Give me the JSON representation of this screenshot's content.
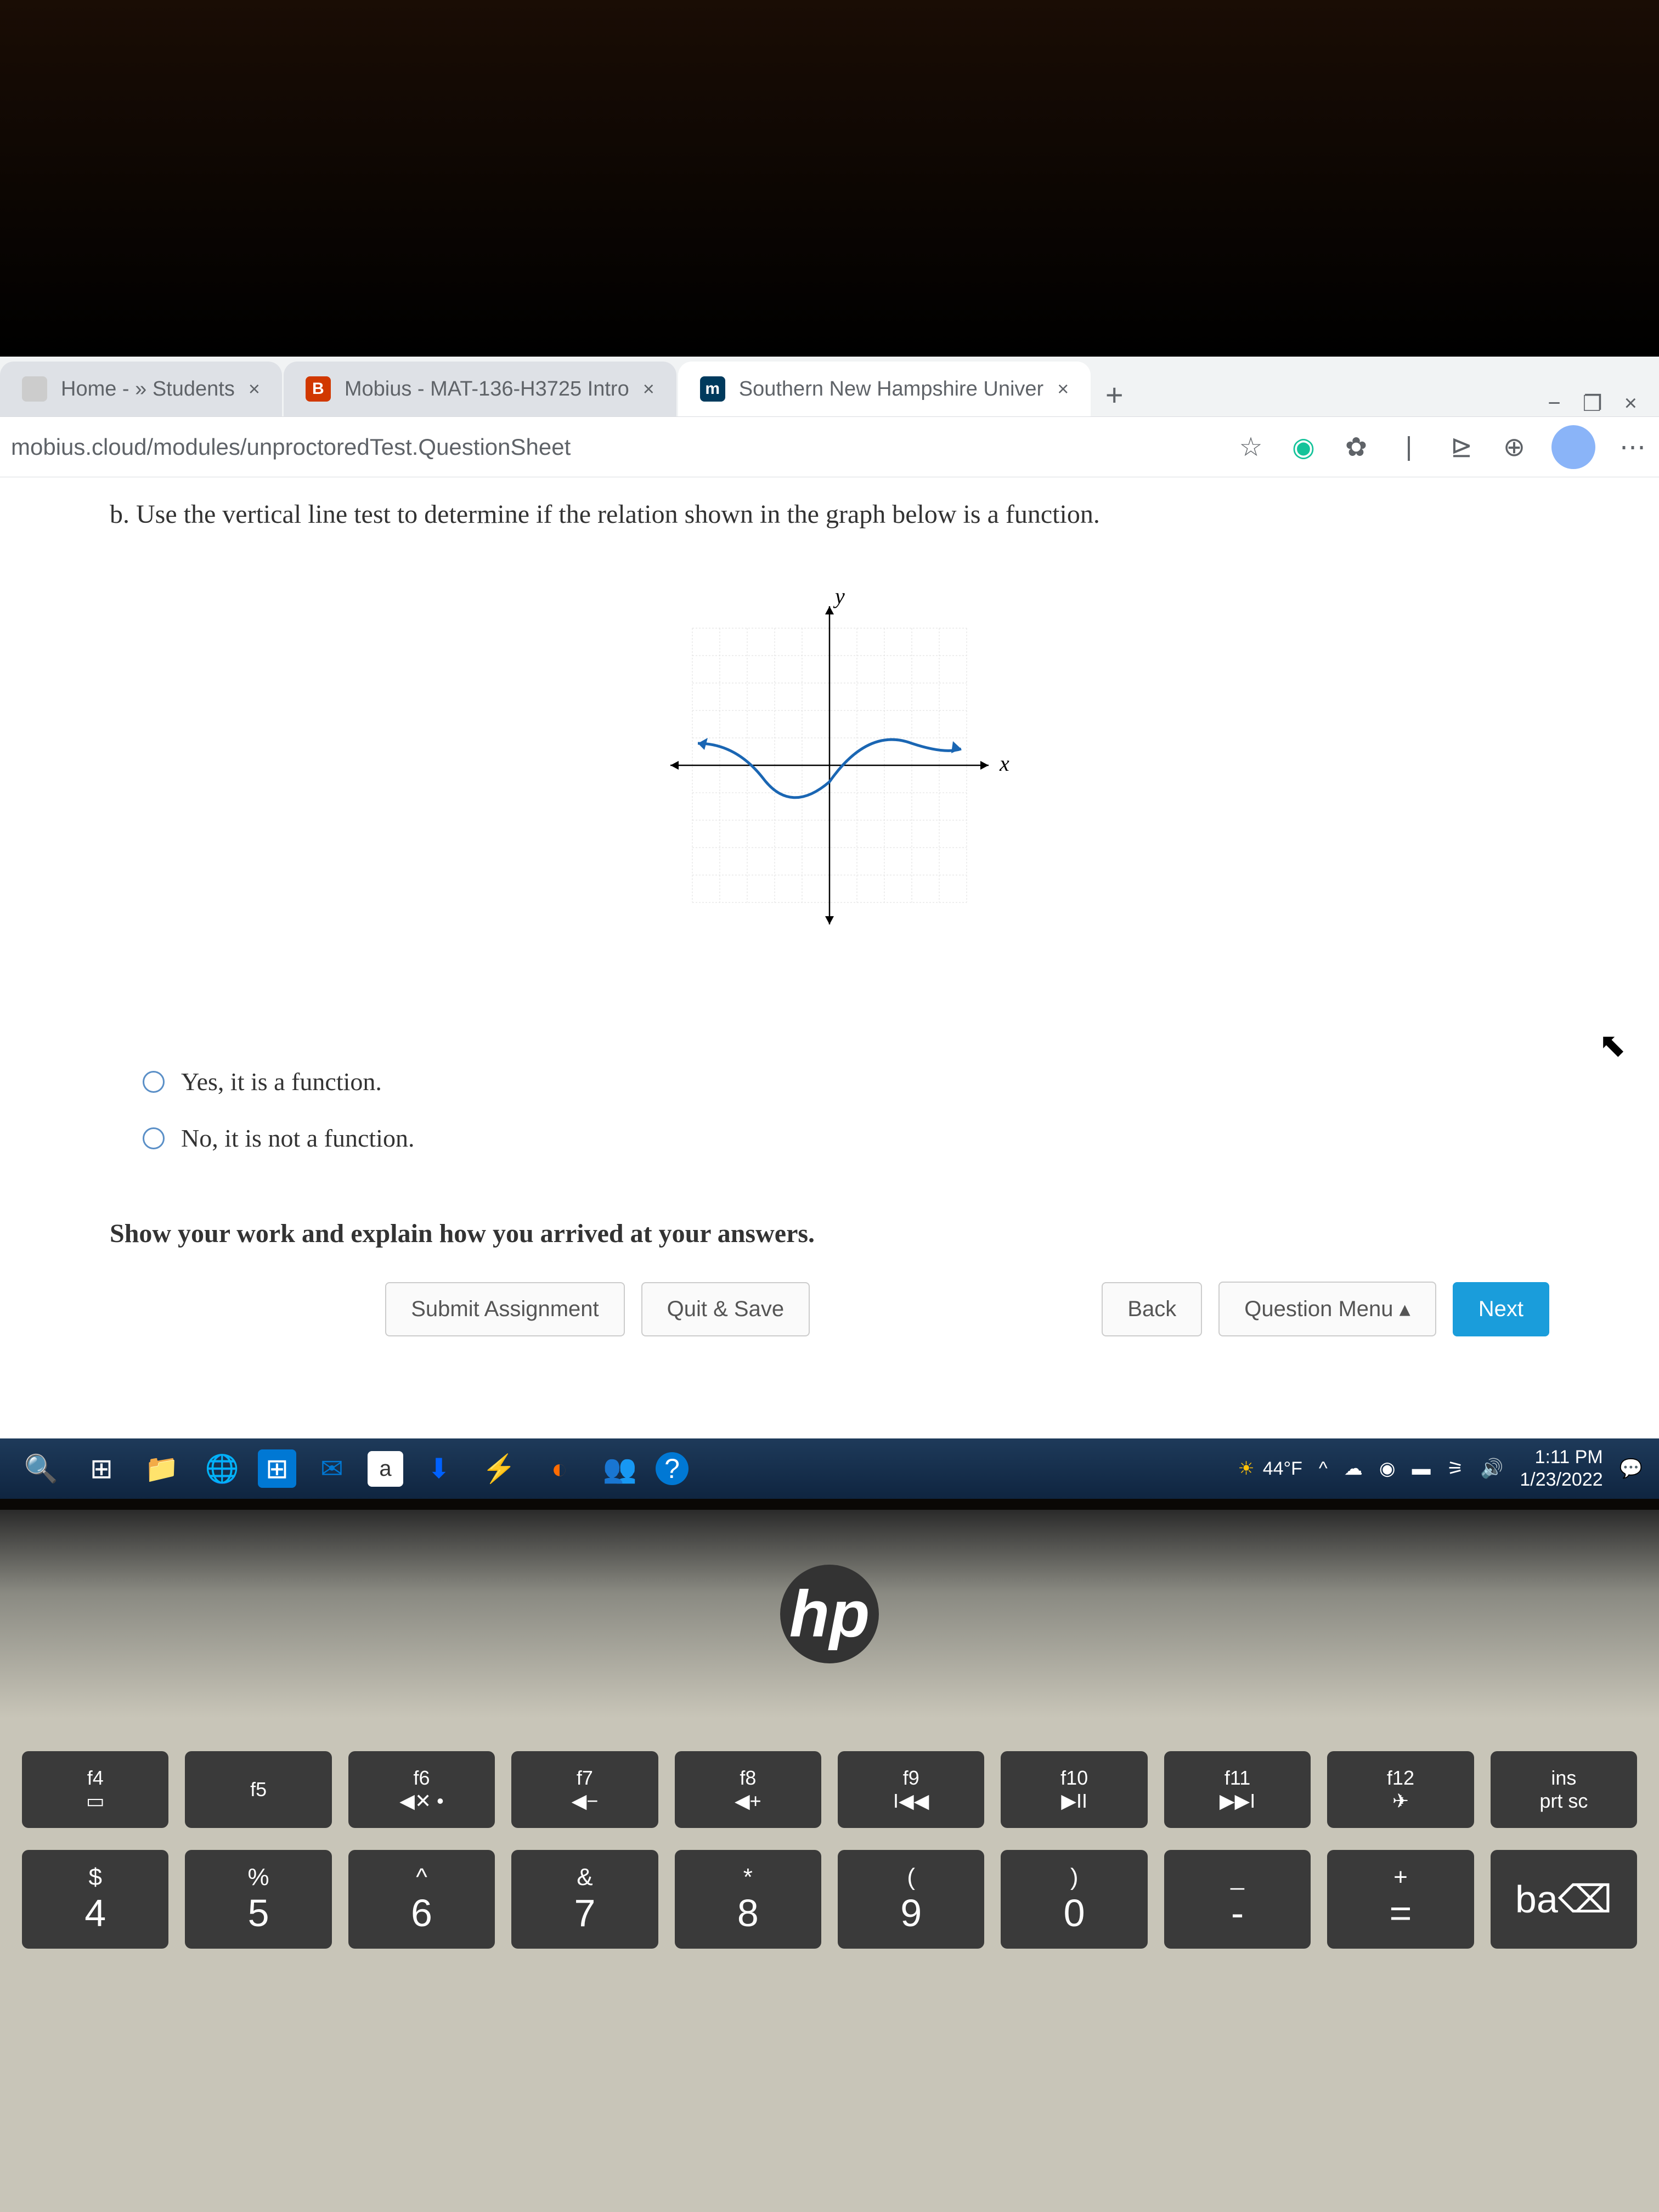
{
  "tabs": [
    {
      "label": "Home - » Students",
      "favicon_color": "#ccc"
    },
    {
      "label": "Mobius - MAT-136-H3725 Intro",
      "favicon_color": "#d13800"
    },
    {
      "label": "Southern New Hampshire Univer",
      "favicon_color": "#003a5d"
    }
  ],
  "url": "mobius.cloud/modules/unproctoredTest.QuestionSheet",
  "question": "b. Use the vertical line test to determine if the relation shown in the graph below is a function.",
  "axis_labels": {
    "x": "x",
    "y": "y"
  },
  "options": [
    "Yes, it is a function.",
    "No, it is not a function."
  ],
  "show_work_label": "Show your work and explain how you arrived at your answers.",
  "buttons": {
    "submit": "Submit Assignment",
    "quit": "Quit & Save",
    "back": "Back",
    "menu": "Question Menu",
    "next": "Next"
  },
  "taskbar": {
    "weather": "44°F",
    "time": "1:11 PM",
    "date": "1/23/2022"
  },
  "hp_logo": "hp",
  "fn_keys": [
    {
      "sub": "f4",
      "icon": "▭"
    },
    {
      "sub": "f5",
      "icon": ""
    },
    {
      "sub": "f6",
      "icon": "◀✕ •"
    },
    {
      "sub": "f7",
      "icon": "◀−"
    },
    {
      "sub": "f8",
      "icon": "◀+"
    },
    {
      "sub": "f9",
      "icon": "I◀◀"
    },
    {
      "sub": "f10",
      "icon": "▶II"
    },
    {
      "sub": "f11",
      "icon": "▶▶I"
    },
    {
      "sub": "f12",
      "icon": "✈"
    },
    {
      "sub": "ins",
      "icon": "prt sc"
    }
  ],
  "num_keys": [
    {
      "sup": "$",
      "main": "4"
    },
    {
      "sup": "%",
      "main": "5"
    },
    {
      "sup": "^",
      "main": "6"
    },
    {
      "sup": "&",
      "main": "7"
    },
    {
      "sup": "*",
      "main": "8"
    },
    {
      "sup": "(",
      "main": "9"
    },
    {
      "sup": ")",
      "main": "0"
    },
    {
      "sup": "_",
      "main": "-"
    },
    {
      "sup": "+",
      "main": "="
    },
    {
      "sup": "",
      "main": "ba⌫"
    }
  ],
  "chart_data": {
    "type": "line",
    "title": "",
    "xlabel": "x",
    "ylabel": "y",
    "xlim": [
      -5,
      5
    ],
    "ylim": [
      -5,
      5
    ],
    "series": [
      {
        "name": "curve",
        "x": [
          -4,
          -3,
          -2,
          -1,
          0,
          1,
          2,
          3,
          4
        ],
        "y": [
          1,
          0.5,
          -0.5,
          -1,
          -0.5,
          1,
          2,
          1.2,
          0.8
        ],
        "color": "#1a66b3"
      }
    ]
  }
}
